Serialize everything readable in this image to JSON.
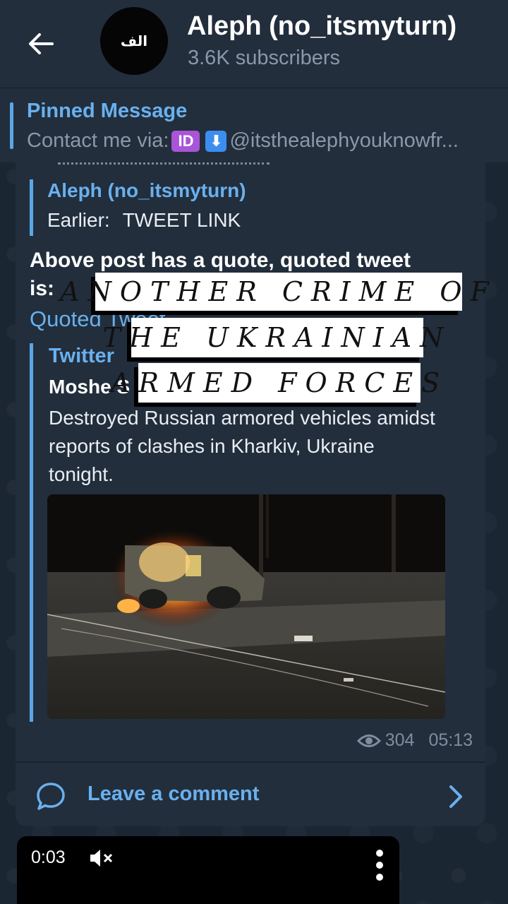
{
  "header": {
    "back_label": "Back",
    "avatar_text": "الف",
    "title": "Aleph (no_itsmyturn)",
    "subtitle": "3.6K subscribers"
  },
  "pinned": {
    "title": "Pinned Message",
    "prefix": "Contact me via:",
    "emoji_id": "ID",
    "emoji_down": "⬇",
    "handle": "@itsthealephyouknowfr..."
  },
  "message": {
    "reply_name": "Aleph (no_itsmyturn)",
    "reply_label": "Earlier:",
    "reply_link": "TWEET LINK",
    "text_line1": "Above post has a quote, quoted tweet",
    "text_line2": "is:",
    "quoted_link": "Quoted Tweet",
    "quote": {
      "source": "Twitter",
      "author": "Moshe S",
      "body": "Destroyed Russian armored vehicles amidst reports of clashes in Kharkiv, Ukraine tonight."
    },
    "views": "304",
    "time": "05:13",
    "comment_label": "Leave a comment"
  },
  "overlay": {
    "line1": "ANOTHER CRIME OF",
    "line2": "THE UKRAINIAN",
    "line3": "ARMED FORCES"
  },
  "video": {
    "time": "0:03"
  },
  "colors": {
    "background": "#1b2633",
    "panel": "#222e3c",
    "accent": "#6ab0ee",
    "muted": "#8a98a8"
  },
  "icons": [
    "back-arrow-icon",
    "eye-icon",
    "comment-bubble-icon",
    "chevron-right-icon",
    "speaker-muted-icon",
    "more-vertical-icon"
  ]
}
